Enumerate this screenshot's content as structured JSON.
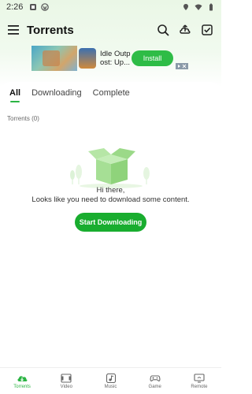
{
  "status_bar": {
    "time": "2:26"
  },
  "app_bar": {
    "title": "Torrents"
  },
  "ad": {
    "text": "Idle Outpost: Up...",
    "text_line1": "Idle Outp",
    "text_line2": "ost: Up...",
    "install_label": "Install"
  },
  "tabs": [
    {
      "label": "All",
      "active": true
    },
    {
      "label": "Downloading",
      "active": false
    },
    {
      "label": "Complete",
      "active": false
    }
  ],
  "torrent_count": "Torrents (0)",
  "empty_state": {
    "line1": "Hi there,",
    "line2": "Looks like you need to download some content.",
    "button_label": "Start Downloading"
  },
  "bottom_nav": [
    {
      "label": "Torrents",
      "icon": "cloud-download-icon",
      "active": true
    },
    {
      "label": "Video",
      "icon": "film-icon",
      "active": false
    },
    {
      "label": "Music",
      "icon": "music-icon",
      "active": false
    },
    {
      "label": "Game",
      "icon": "gamepad-icon",
      "active": false
    },
    {
      "label": "Remote",
      "icon": "remote-screen-icon",
      "active": false
    }
  ],
  "colors": {
    "accent": "#2bb443",
    "button": "#19ad2f",
    "background_tint": "#eaf7e6"
  }
}
